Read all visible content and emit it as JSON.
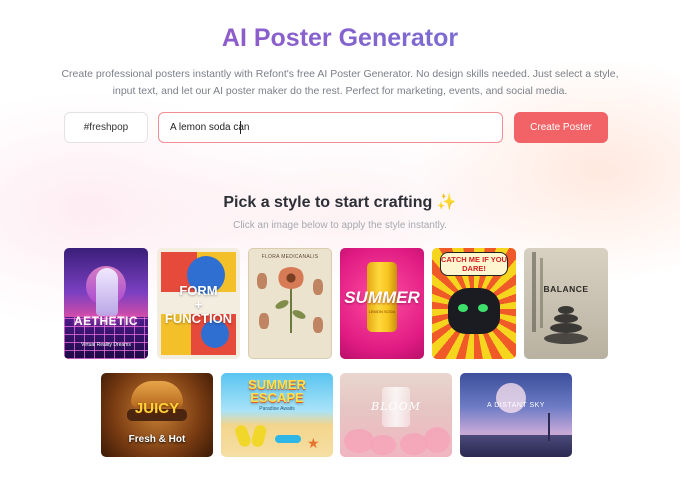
{
  "header": {
    "title": "AI Poster Generator",
    "subtitle": "Create professional posters instantly with Refont's free AI Poster Generator. No design skills needed. Just select a style, input text, and let our AI poster maker do the rest. Perfect for marketing, events, and social media."
  },
  "form": {
    "tag_value": "#freshpop",
    "prompt_value": "A lemon soda can",
    "create_label": "Create Poster"
  },
  "styles_section": {
    "title": "Pick a style to start crafting ✨",
    "subtitle": "Click an image below to apply the style instantly."
  },
  "posters": {
    "aethetic": {
      "title": "AETHETIC",
      "subtitle": "Virtual Reality Dreams"
    },
    "form_function": {
      "title": "FORM\n+\nFUNCTION"
    },
    "flora": {
      "title": "FLORA MEDICANALIS"
    },
    "summer_can": {
      "title": "SUMMER",
      "subtitle": "LEMON SODA"
    },
    "catch_me": {
      "title": "CATCH ME IF YOU DARE!"
    },
    "balance": {
      "title": "BALANCE"
    },
    "juicy": {
      "title": "JUICY",
      "subtitle": "Fresh & Hot"
    },
    "summer_escape": {
      "title": "SUMMER\nESCAPE",
      "subtitle": "Paradise Awaits"
    },
    "bloom": {
      "title": "BLOOM"
    },
    "distant_sky": {
      "title": "A DISTANT SKY"
    }
  },
  "colors": {
    "title_gradient_start": "#a04cc4",
    "title_gradient_end": "#6f7fd6",
    "button": "#f16366",
    "prompt_border": "#f08e93"
  }
}
